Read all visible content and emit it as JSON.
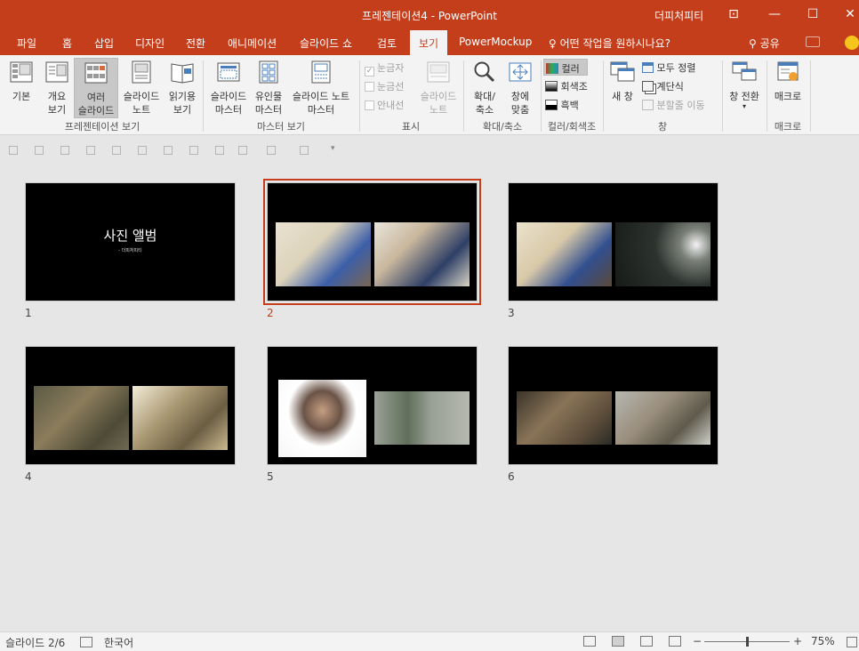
{
  "window": {
    "title": "프레젠테이션4 - PowerPoint",
    "user": "더피처피티",
    "controls": [
      "⊡",
      "—",
      "☐",
      "✕"
    ]
  },
  "tabs": [
    "파일",
    "홈",
    "삽입",
    "디자인",
    "전환",
    "애니메이션",
    "슬라이드 쇼",
    "검토",
    "보기",
    "PowerMockup"
  ],
  "active_tab": "보기",
  "tell_me": "어떤 작업을 원하시나요?",
  "share": "공유",
  "ribbon": {
    "pres_views": {
      "label": "프레젠테이션 보기",
      "normal": "기본",
      "outline_l1": "개요",
      "outline_l2": "보기",
      "sorter_l1": "여러",
      "sorter_l2": "슬라이드",
      "notes_l1": "슬라이드",
      "notes_l2": "노트",
      "reading_l1": "읽기용",
      "reading_l2": "보기"
    },
    "master_views": {
      "label": "마스터 보기",
      "slide_l1": "슬라이드",
      "slide_l2": "마스터",
      "handout_l1": "유인물",
      "handout_l2": "마스터",
      "notes_l1": "슬라이드 노트",
      "notes_l2": "마스터"
    },
    "show": {
      "label": "표시",
      "ruler": "눈금자",
      "gridlines": "눈금선",
      "guides": "안내선",
      "notes_l1": "슬라이드",
      "notes_l2": "노트"
    },
    "zoom": {
      "label": "확대/축소",
      "zoom_l1": "확대/",
      "zoom_l2": "축소",
      "fit_l1": "창에",
      "fit_l2": "맞춤"
    },
    "color": {
      "label": "컬러/회색조",
      "color": "컬러",
      "grayscale": "회색조",
      "bw": "흑백"
    },
    "window": {
      "label": "창",
      "new_window": "새 창",
      "arrange_all": "모두 정렬",
      "cascade": "계단식",
      "split": "분할줄 이동",
      "switch": "창 전환"
    },
    "macros": {
      "label": "매크로",
      "macros": "매크로"
    }
  },
  "slides": [
    {
      "num": "1",
      "title": "사진 앨범",
      "subtitle": "- 더피처피티"
    },
    {
      "num": "2"
    },
    {
      "num": "3"
    },
    {
      "num": "4"
    },
    {
      "num": "5"
    },
    {
      "num": "6"
    }
  ],
  "selected_slide": "2",
  "status": {
    "slide_count": "슬라이드 2/6",
    "language": "한국어",
    "zoom": "75%",
    "zoom_level": 0.5
  },
  "colors": {
    "accent": "#c43e1c",
    "background": "#e6e6e6",
    "ribbon": "#f3f3f3"
  }
}
